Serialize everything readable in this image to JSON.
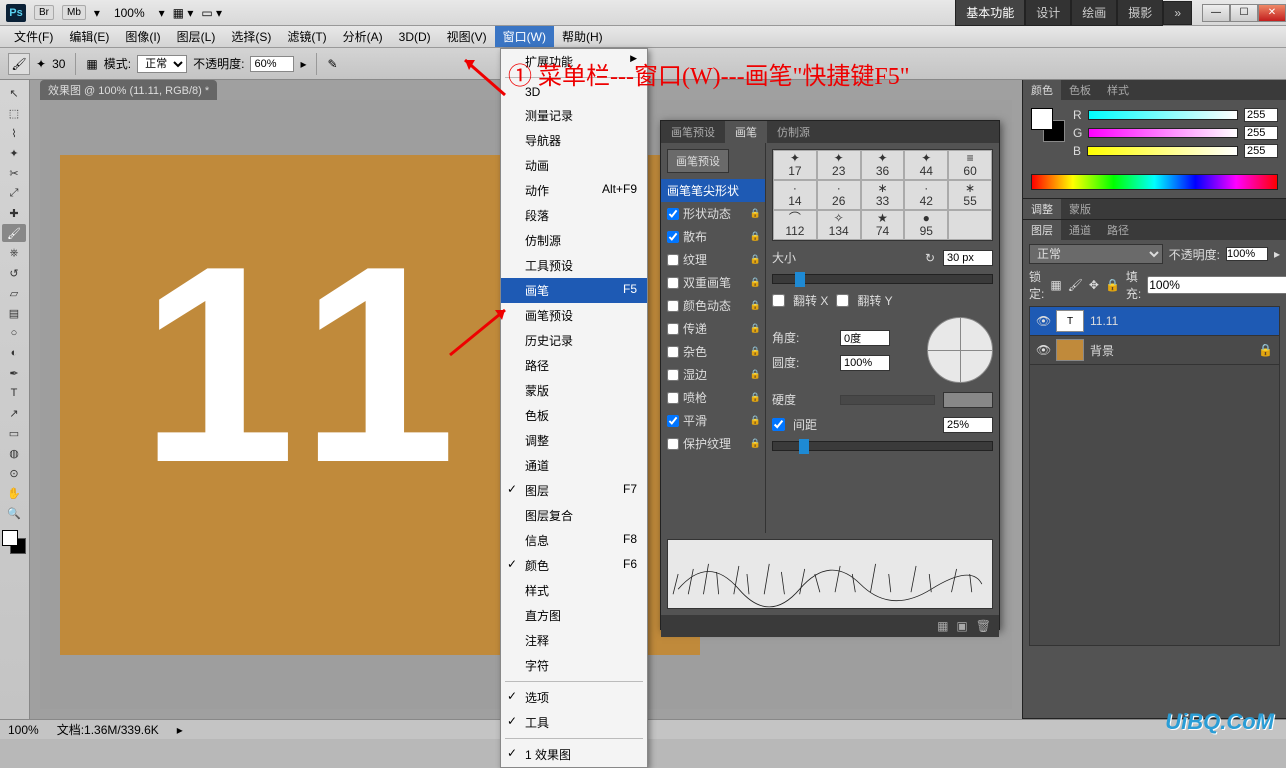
{
  "titlebar": {
    "ps": "Ps",
    "br": "Br",
    "mb": "Mb",
    "zoom": "100%",
    "workspaces": [
      "基本功能",
      "设计",
      "绘画",
      "摄影"
    ],
    "more": "»"
  },
  "menubar": {
    "items": [
      "文件(F)",
      "编辑(E)",
      "图像(I)",
      "图层(L)",
      "选择(S)",
      "滤镜(T)",
      "分析(A)",
      "3D(D)",
      "视图(V)",
      "窗口(W)",
      "帮助(H)"
    ],
    "openIndex": 9
  },
  "optbar": {
    "brushSize": "30",
    "modeLabel": "模式:",
    "modeValue": "正常",
    "opacityLabel": "不透明度:",
    "opacityValue": "60%"
  },
  "docTab": "效果图 @ 100% (11.11, RGB/8) *",
  "canvasText": "11",
  "windowMenu": [
    {
      "label": "扩展功能",
      "sub": true
    },
    {
      "sep": true
    },
    {
      "label": "3D"
    },
    {
      "label": "测量记录"
    },
    {
      "label": "导航器"
    },
    {
      "label": "动画"
    },
    {
      "label": "动作",
      "shortcut": "Alt+F9"
    },
    {
      "label": "段落"
    },
    {
      "label": "仿制源"
    },
    {
      "label": "工具预设"
    },
    {
      "label": "画笔",
      "shortcut": "F5",
      "selected": true
    },
    {
      "label": "画笔预设"
    },
    {
      "label": "历史记录"
    },
    {
      "label": "路径"
    },
    {
      "label": "蒙版"
    },
    {
      "label": "色板"
    },
    {
      "label": "调整"
    },
    {
      "label": "通道"
    },
    {
      "label": "图层",
      "shortcut": "F7",
      "checked": true
    },
    {
      "label": "图层复合"
    },
    {
      "label": "信息",
      "shortcut": "F8"
    },
    {
      "label": "颜色",
      "shortcut": "F6",
      "checked": true
    },
    {
      "label": "样式"
    },
    {
      "label": "直方图"
    },
    {
      "label": "注释"
    },
    {
      "label": "字符"
    },
    {
      "sep": true
    },
    {
      "label": "选项",
      "checked": true
    },
    {
      "label": "工具",
      "checked": true
    },
    {
      "sep": true
    },
    {
      "label": "1 效果图",
      "checked": true
    }
  ],
  "brushPanel": {
    "tabs": [
      "画笔预设",
      "画笔",
      "仿制源"
    ],
    "activeTab": 1,
    "presetBtn": "画笔预设",
    "opts": [
      {
        "label": "画笔笔尖形状",
        "hl": true,
        "noCheck": true
      },
      {
        "label": "形状动态",
        "checked": true,
        "lock": true
      },
      {
        "label": "散布",
        "checked": true,
        "lock": true
      },
      {
        "label": "纹理",
        "checked": false,
        "lock": true
      },
      {
        "label": "双重画笔",
        "checked": false,
        "lock": true
      },
      {
        "label": "颜色动态",
        "checked": false,
        "lock": true
      },
      {
        "label": "传递",
        "checked": false,
        "lock": true
      },
      {
        "label": "杂色",
        "checked": false,
        "lock": true
      },
      {
        "label": "湿边",
        "checked": false,
        "lock": true
      },
      {
        "label": "喷枪",
        "checked": false,
        "lock": true
      },
      {
        "label": "平滑",
        "checked": true,
        "lock": true
      },
      {
        "label": "保护纹理",
        "checked": false,
        "lock": true
      }
    ],
    "brushes": [
      {
        "g": "✦",
        "n": "17"
      },
      {
        "g": "✦",
        "n": "23"
      },
      {
        "g": "✦",
        "n": "36"
      },
      {
        "g": "✦",
        "n": "44"
      },
      {
        "g": "≡",
        "n": "60"
      },
      {
        "g": "·",
        "n": "14"
      },
      {
        "g": "·",
        "n": "26"
      },
      {
        "g": "∗",
        "n": "33"
      },
      {
        "g": "·",
        "n": "42"
      },
      {
        "g": "∗",
        "n": "55"
      },
      {
        "g": "⌒",
        "n": "112"
      },
      {
        "g": "✧",
        "n": "134"
      },
      {
        "g": "★",
        "n": "74"
      },
      {
        "g": "●",
        "n": "95"
      },
      {
        "g": "",
        "n": ""
      }
    ],
    "sizeLabel": "大小",
    "sizeValue": "30 px",
    "flipX": "翻转 X",
    "flipY": "翻转 Y",
    "angleLabel": "角度:",
    "angleValue": "0度",
    "roundLabel": "圆度:",
    "roundValue": "100%",
    "hardLabel": "硬度",
    "spacingLabel": "间距",
    "spacingValue": "25%",
    "spacingChecked": true
  },
  "colorPanel": {
    "tabs": [
      "颜色",
      "色板",
      "样式"
    ],
    "activeTab": 0,
    "r": "255",
    "g": "255",
    "b": "255",
    "R": "R",
    "G": "G",
    "B": "B"
  },
  "adjustPanel": {
    "tabs": [
      "调整",
      "蒙版"
    ],
    "activeTab": 0
  },
  "layersPanel": {
    "tabs": [
      "图层",
      "通道",
      "路径"
    ],
    "activeTab": 0,
    "blend": "正常",
    "opacityLabel": "不透明度:",
    "opacity": "100%",
    "lockLabel": "锁定:",
    "fillLabel": "填充:",
    "fill": "100%",
    "layers": [
      {
        "name": "11.11",
        "type": "T",
        "sel": true
      },
      {
        "name": "背景",
        "type": "bg",
        "sel": false
      }
    ]
  },
  "status": {
    "zoom": "100%",
    "doc": "文档:1.36M/339.6K"
  },
  "annotation": "① 菜单栏---窗口(W)---画笔\"快捷键F5\"",
  "watermark": "UiBQ.CoM"
}
